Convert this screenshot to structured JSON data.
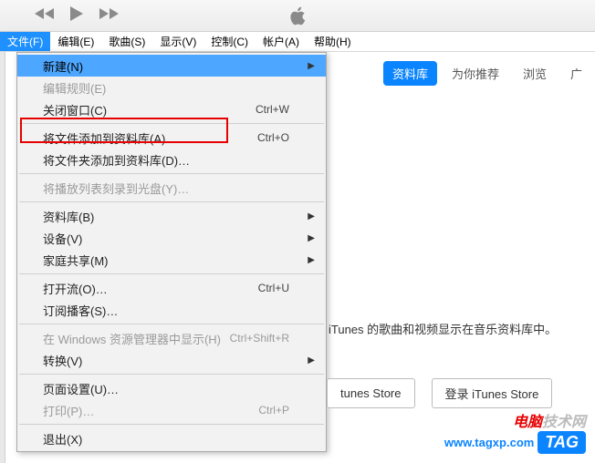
{
  "menubar": {
    "file": "文件(F)",
    "edit": "编辑(E)",
    "song": "歌曲(S)",
    "view": "显示(V)",
    "control": "控制(C)",
    "account": "帐户(A)",
    "help": "帮助(H)"
  },
  "tabs": {
    "library": "资料库",
    "for_you": "为你推荐",
    "browse": "浏览",
    "radio": "广"
  },
  "dropdown": {
    "new": {
      "label": "新建(N)"
    },
    "edit_rule": {
      "label": "编辑规则(E)"
    },
    "close_window": {
      "label": "关闭窗口(C)",
      "shortcut": "Ctrl+W"
    },
    "add_file": {
      "label": "将文件添加到资料库(A)…",
      "shortcut": "Ctrl+O"
    },
    "add_folder": {
      "label": "将文件夹添加到资料库(D)…"
    },
    "burn_playlist": {
      "label": "将播放列表刻录到光盘(Y)…"
    },
    "library": {
      "label": "资料库(B)"
    },
    "devices": {
      "label": "设备(V)"
    },
    "home_sharing": {
      "label": "家庭共享(M)"
    },
    "open_stream": {
      "label": "打开流(O)…",
      "shortcut": "Ctrl+U"
    },
    "subscribe_podcast": {
      "label": "订阅播客(S)…"
    },
    "show_in_explorer": {
      "label": "在 Windows 资源管理器中显示(H)",
      "shortcut": "Ctrl+Shift+R"
    },
    "convert": {
      "label": "转换(V)"
    },
    "page_setup": {
      "label": "页面设置(U)…"
    },
    "print": {
      "label": "打印(P)…",
      "shortcut": "Ctrl+P"
    },
    "exit": {
      "label": "退出(X)"
    }
  },
  "main": {
    "description": "iTunes 的歌曲和视频显示在音乐资料库中。"
  },
  "buttons": {
    "go_store": "tunes Store",
    "login_store": "登录 iTunes Store"
  },
  "watermark": {
    "brand_left": "电脑",
    "brand_right": "技术网",
    "url": "www.tagxp.com",
    "tag": "TAG"
  }
}
